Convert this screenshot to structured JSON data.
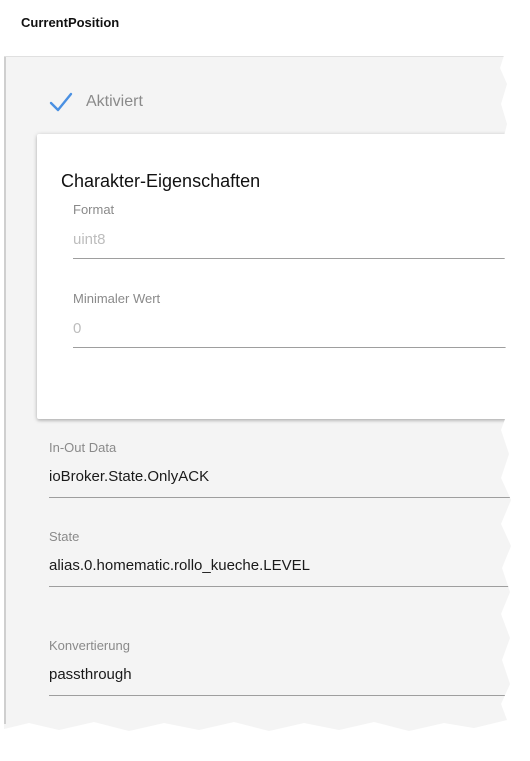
{
  "header": {
    "title": "CurrentPosition"
  },
  "activated": {
    "label": "Aktiviert",
    "checked": true,
    "icon": "check-icon",
    "accent": "#4a90e2"
  },
  "characteristics": {
    "title": "Charakter-Eigenschaften",
    "format": {
      "label": "Format",
      "value": "uint8"
    },
    "min_value": {
      "label": "Minimaler Wert",
      "value": "0"
    }
  },
  "in_out_data": {
    "label": "In-Out Data",
    "value": "ioBroker.State.OnlyACK"
  },
  "state": {
    "label": "State",
    "value": "alias.0.homematic.rollo_kueche.LEVEL"
  },
  "conversion": {
    "label": "Konvertierung",
    "value": "passthrough"
  }
}
